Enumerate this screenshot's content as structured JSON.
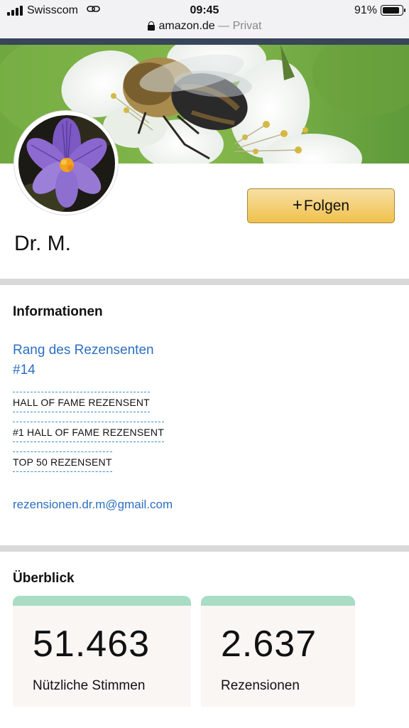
{
  "status_bar": {
    "carrier": "Swisscom",
    "time": "09:45",
    "battery_percent": "91%",
    "battery_level": 0.91
  },
  "url_bar": {
    "domain": "amazon.de",
    "separator": " — ",
    "mode": "Privat"
  },
  "profile": {
    "name": "Dr. M.",
    "follow_plus": "+",
    "follow_label": "Folgen"
  },
  "information": {
    "title": "Informationen",
    "rank_label": "Rang des Rezensenten",
    "rank_value": "#14",
    "badges": [
      "HALL OF FAME REZENSENT",
      "#1 HALL OF FAME REZENSENT",
      "TOP 50 REZENSENT"
    ],
    "email": "rezensionen.dr.m@gmail.com"
  },
  "overview": {
    "title": "Überblick",
    "stats": [
      {
        "value": "51.463",
        "label": "Nützliche Stimmen"
      },
      {
        "value": "2.637",
        "label": "Rezensionen"
      }
    ]
  },
  "colors": {
    "link": "#2d6fc1",
    "button_gradient_top": "#f7dfa5",
    "button_gradient_bottom": "#f0c14b",
    "card_accent": "#a8dcc4",
    "header_strip": "#38455a"
  },
  "icons": {
    "signal": "cellular-signal-icon",
    "link": "link-chain-icon",
    "lock": "lock-icon",
    "battery": "battery-icon"
  }
}
